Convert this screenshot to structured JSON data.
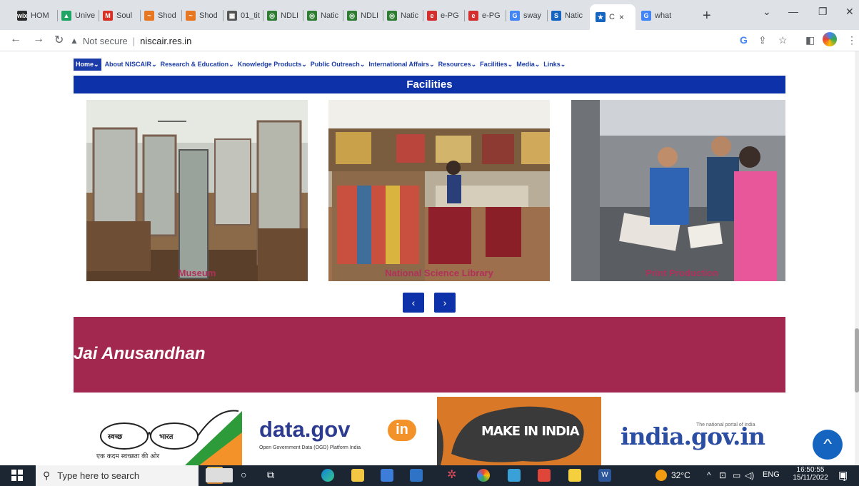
{
  "browser": {
    "tabs": [
      {
        "label": "HOM",
        "icon": "wix-icon",
        "glyph": "wix",
        "color": "#2d2d2d"
      },
      {
        "label": "Unive",
        "icon": "google-drive-icon",
        "glyph": "▲",
        "color": "#1fa463"
      },
      {
        "label": "Soul",
        "icon": "gmail-icon",
        "glyph": "M",
        "color": "#d93025"
      },
      {
        "label": "Shod",
        "icon": "shodhganga-icon",
        "glyph": "~",
        "color": "#e87722"
      },
      {
        "label": "Shod",
        "icon": "shodhganga-icon",
        "glyph": "~",
        "color": "#e87722"
      },
      {
        "label": "01_tit",
        "icon": "image-file-icon",
        "glyph": "▦",
        "color": "#555555"
      },
      {
        "label": "NDLI",
        "icon": "ndli-icon",
        "glyph": "◎",
        "color": "#2e7d32"
      },
      {
        "label": "Natic",
        "icon": "ndli-icon",
        "glyph": "◎",
        "color": "#2e7d32"
      },
      {
        "label": "NDLI",
        "icon": "ndli-icon",
        "glyph": "◎",
        "color": "#2e7d32"
      },
      {
        "label": "Natic",
        "icon": "ndli-icon",
        "glyph": "◎",
        "color": "#2e7d32"
      },
      {
        "label": "e-PG",
        "icon": "epg-icon",
        "glyph": "e",
        "color": "#d32f2f"
      },
      {
        "label": "e-PG",
        "icon": "epg-icon",
        "glyph": "e",
        "color": "#d32f2f"
      },
      {
        "label": "sway",
        "icon": "google-icon",
        "glyph": "G",
        "color": "#4285f4"
      },
      {
        "label": "Natic",
        "icon": "s-icon",
        "glyph": "S",
        "color": "#1565c0"
      },
      {
        "label": "C",
        "icon": "niscair-icon",
        "glyph": "★",
        "color": "#1565c0",
        "active": true
      },
      {
        "label": "what",
        "icon": "google-icon",
        "glyph": "G",
        "color": "#4285f4"
      }
    ],
    "url_security": "Not secure",
    "url": "niscair.res.in",
    "new_tab": "+",
    "close_tab": "×"
  },
  "site": {
    "nav": {
      "home": "Home",
      "items": [
        "About NISCAIR",
        "Research & Education",
        "Knowledge Products",
        "Public Outreach",
        "International Affairs",
        "Resources",
        "Facilities",
        "Media",
        "Links"
      ]
    },
    "facilities_title": "Facilities",
    "facilities": [
      {
        "caption": "Museum"
      },
      {
        "caption": "National Science Library"
      },
      {
        "caption": "Print Production"
      }
    ],
    "prev": "‹",
    "next": "›",
    "banner_title": "Jai Anusandhan",
    "logos": {
      "swachh_left": "स्वच्छ",
      "swachh_right": "भारत",
      "swachh_tag": "एक कदम स्वच्छता की ओर",
      "datagov_main": "data.gov",
      "datagov_in": "in",
      "datagov_sub": "Open Government Data (OGD) Platform India",
      "makeinindia": "MAKE IN INDIA",
      "indiagov_small": "The national portal of india",
      "indiagov_main": "india.gov.in"
    },
    "scroll_top": "^"
  },
  "taskbar": {
    "search_placeholder": "Type here to search",
    "temperature": "32°C",
    "language": "ENG",
    "time": "16:50:55",
    "date": "15/11/2022",
    "notifications": "1"
  }
}
